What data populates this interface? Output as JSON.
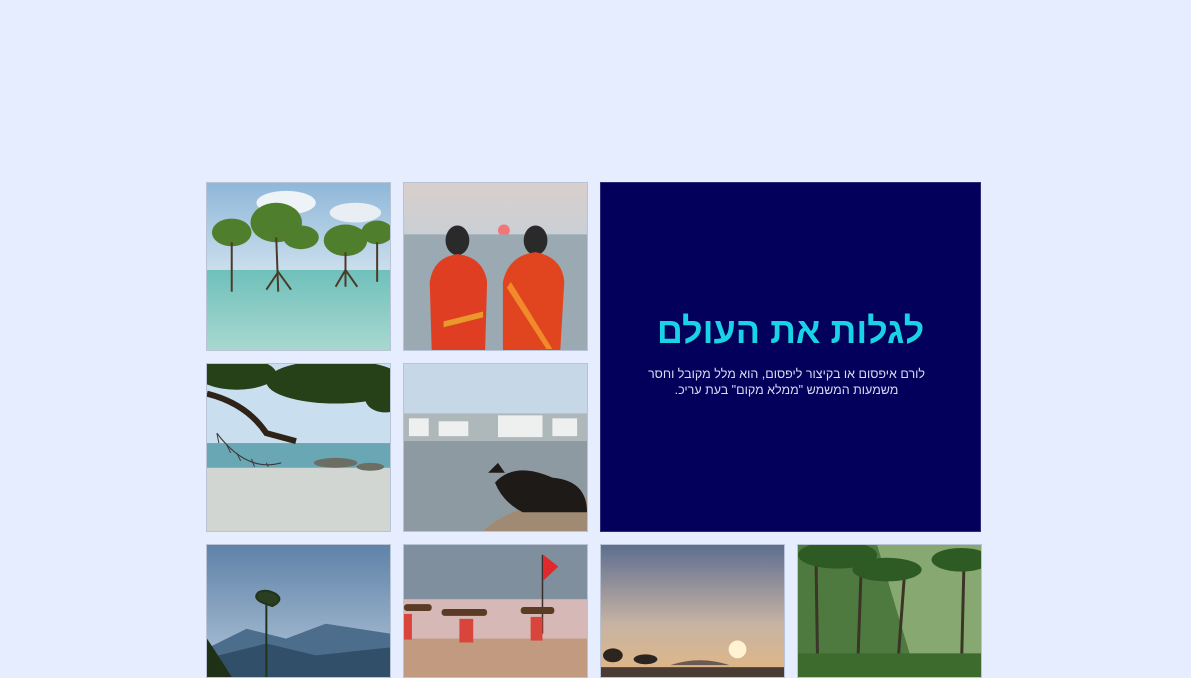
{
  "hero": {
    "title": "לגלות את העולם",
    "text": "לורם איפסום או בקיצור ליפסום, הוא מלל מקובל וחסר משמעות המשמש \"ממלא מקום\" בעת עריכ."
  },
  "gallery": {
    "photos": [
      {
        "subject": "mangrove trees in turquoise sea"
      },
      {
        "subject": "two women in red saris facing the sea at sunset"
      },
      {
        "subject": "beach with hammock under tree branches"
      },
      {
        "subject": "cow resting by lake with white town behind"
      },
      {
        "subject": "misty blue mountains with tall tree"
      },
      {
        "subject": "people carrying bundles on heads on beach with red flag"
      },
      {
        "subject": "sunset over sea with tree silhouettes"
      },
      {
        "subject": "sunlight through palm trees in forest"
      }
    ]
  },
  "colors": {
    "background": "#e5edfe",
    "hero_background": "#02005a",
    "hero_title": "#19d2e6",
    "hero_text": "#d9dcf4"
  }
}
